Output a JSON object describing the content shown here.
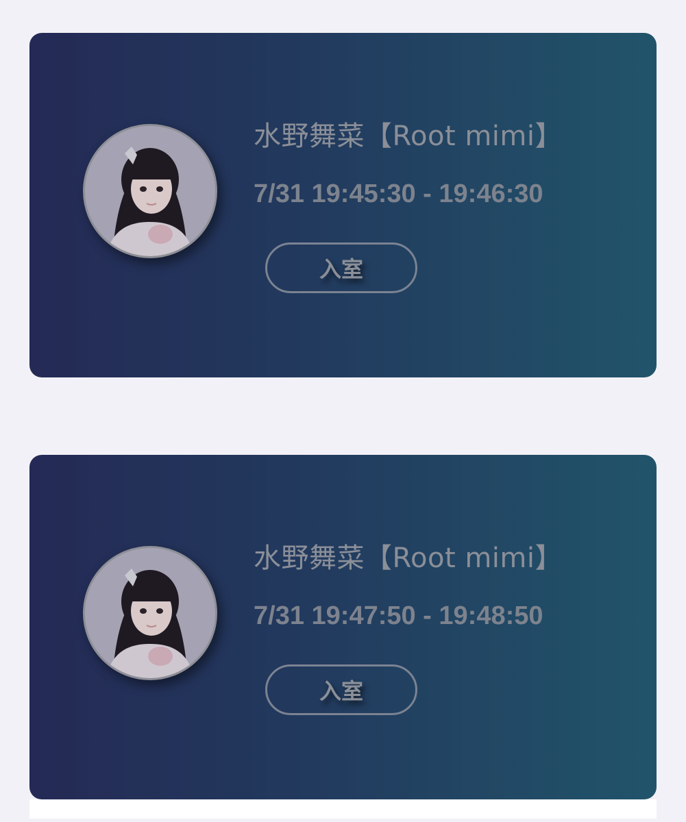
{
  "colors": {
    "page_background": "#f2f1f7",
    "card_gradient_start": "#242a55",
    "card_gradient_end": "#21546a",
    "text_muted": "#8b8f98"
  },
  "sessions": [
    {
      "name": "水野舞菜【Root mimi】",
      "time_range": "7/31 19:45:30 - 19:46:30",
      "button_label": "入室",
      "avatar_icon": "idol-portrait-avatar"
    },
    {
      "name": "水野舞菜【Root mimi】",
      "time_range": "7/31 19:47:50 - 19:48:50",
      "button_label": "入室",
      "avatar_icon": "idol-portrait-avatar"
    }
  ]
}
